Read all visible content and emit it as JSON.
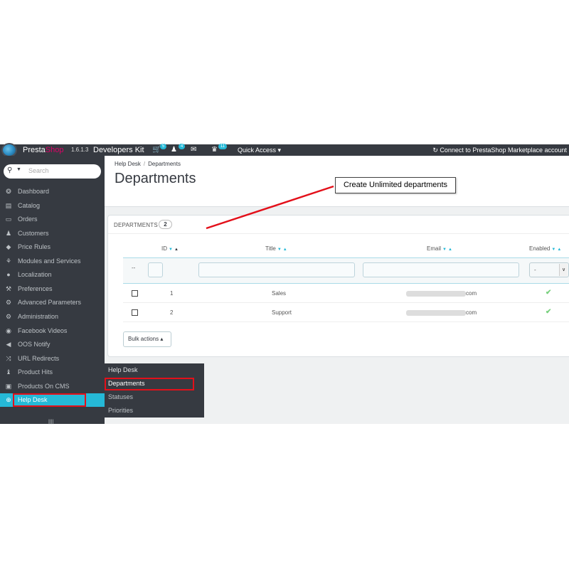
{
  "header": {
    "brand_part1": "Presta",
    "brand_part2": "Shop",
    "version": "1.6.1.3",
    "shop_name": "Developers Kit",
    "cart_badge": "5",
    "customers_badge": "4",
    "trophy_badge": "11",
    "quick_access": "Quick Access ▾",
    "marketplace": "Connect to PrestaShop Marketplace account"
  },
  "search": {
    "placeholder": "Search"
  },
  "sidebar": {
    "items": [
      {
        "label": "Dashboard",
        "icon": "❂"
      },
      {
        "label": "Catalog",
        "icon": "▤"
      },
      {
        "label": "Orders",
        "icon": "▭"
      },
      {
        "label": "Customers",
        "icon": "♟"
      },
      {
        "label": "Price Rules",
        "icon": "◆"
      },
      {
        "label": "Modules and Services",
        "icon": "⚘"
      },
      {
        "label": "Localization",
        "icon": "●"
      },
      {
        "label": "Preferences",
        "icon": "⚒"
      },
      {
        "label": "Advanced Parameters",
        "icon": "⚙"
      },
      {
        "label": "Administration",
        "icon": "⚙"
      },
      {
        "label": "Facebook Videos",
        "icon": "◉"
      },
      {
        "label": "OOS Notify",
        "icon": "◀"
      },
      {
        "label": "URL Redirects",
        "icon": "⤨"
      },
      {
        "label": "Product Hits",
        "icon": "♝"
      },
      {
        "label": "Products On CMS",
        "icon": "▣"
      },
      {
        "label": "Help Desk",
        "icon": "⊕"
      }
    ],
    "collapse_icon": "||||"
  },
  "flyout": {
    "items": [
      "Help Desk",
      "Departments",
      "Statuses",
      "Priorities"
    ]
  },
  "breadcrumb": {
    "parent": "Help Desk",
    "separator": "/",
    "current": "Departments"
  },
  "page": {
    "title": "Departments"
  },
  "panel": {
    "title": "DEPARTMENTS",
    "count": "2"
  },
  "table": {
    "columns": [
      "ID",
      "Title",
      "Email",
      "Enabled"
    ],
    "filter_dash": "--",
    "filter_enabled_value": "-",
    "rows": [
      {
        "id": "1",
        "title": "Sales",
        "email_suffix": "com",
        "enabled": "✔"
      },
      {
        "id": "2",
        "title": "Support",
        "email_suffix": "com",
        "enabled": "✔"
      }
    ],
    "bulk_actions": "Bulk actions ▴"
  },
  "annotation": {
    "text": "Create Unlimited departments"
  },
  "colors": {
    "sidebar_bg": "#363a41",
    "accent": "#25b9d7",
    "annotation_red": "#e3101a",
    "enabled_green": "#78d07d"
  }
}
